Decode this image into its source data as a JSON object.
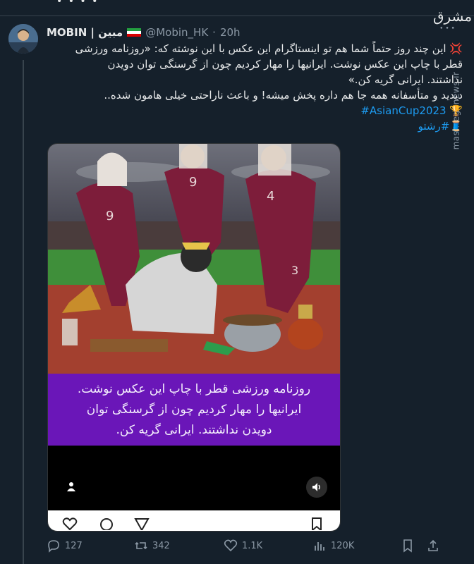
{
  "topbar": {
    "dots": "• • • •"
  },
  "tweet": {
    "display_name": "MOBIN | مبین",
    "handle": "@Mobin_HK",
    "separator": "·",
    "time": "20h",
    "body_lines": [
      "💢 این چند روز حتماً شما هم تو اینستاگرام این عکس با این نوشته که: «روزنامه ورزشی",
      "قطر با چاپ این عکس نوشت. ایرانیها را مهار کردیم چون از گرسنگی توان دویدن",
      "نداشتند. ایرانی گریه کن.»",
      "دیدید و متأسفانه همه جا هم داره پخش میشه! و باعث ناراحتی خیلی هامون شده.."
    ],
    "hashtag_1": "#AsianCup2023",
    "hashtag_1_icon": "🏆",
    "hashtag_2": "#رشتو",
    "hashtag_2_icon": "🧵"
  },
  "media": {
    "caption_lines": [
      "روزنامه ورزشی قطر با چاپ این عکس نوشت.",
      "ایرانیها را مهار کردیم چون از گرسنگی توان",
      "دویدن نداشتند. ایرانی گریه کن."
    ],
    "jersey_numbers": [
      "9",
      "9",
      "4",
      "3"
    ],
    "icons": [
      "user-icon",
      "sound-icon",
      "heart-icon",
      "comment-icon",
      "send-icon",
      "bookmark-icon"
    ]
  },
  "actions": {
    "replies": "127",
    "retweets": "342",
    "likes": "1.1K",
    "views": "120K"
  },
  "watermark": {
    "logo": "مشرق",
    "side_text": "mashreghnews.ir"
  },
  "colors": {
    "background": "#15202b",
    "accent": "#1d9bf0",
    "caption_bg": "#6a16b8",
    "muted": "#8b98a5"
  }
}
